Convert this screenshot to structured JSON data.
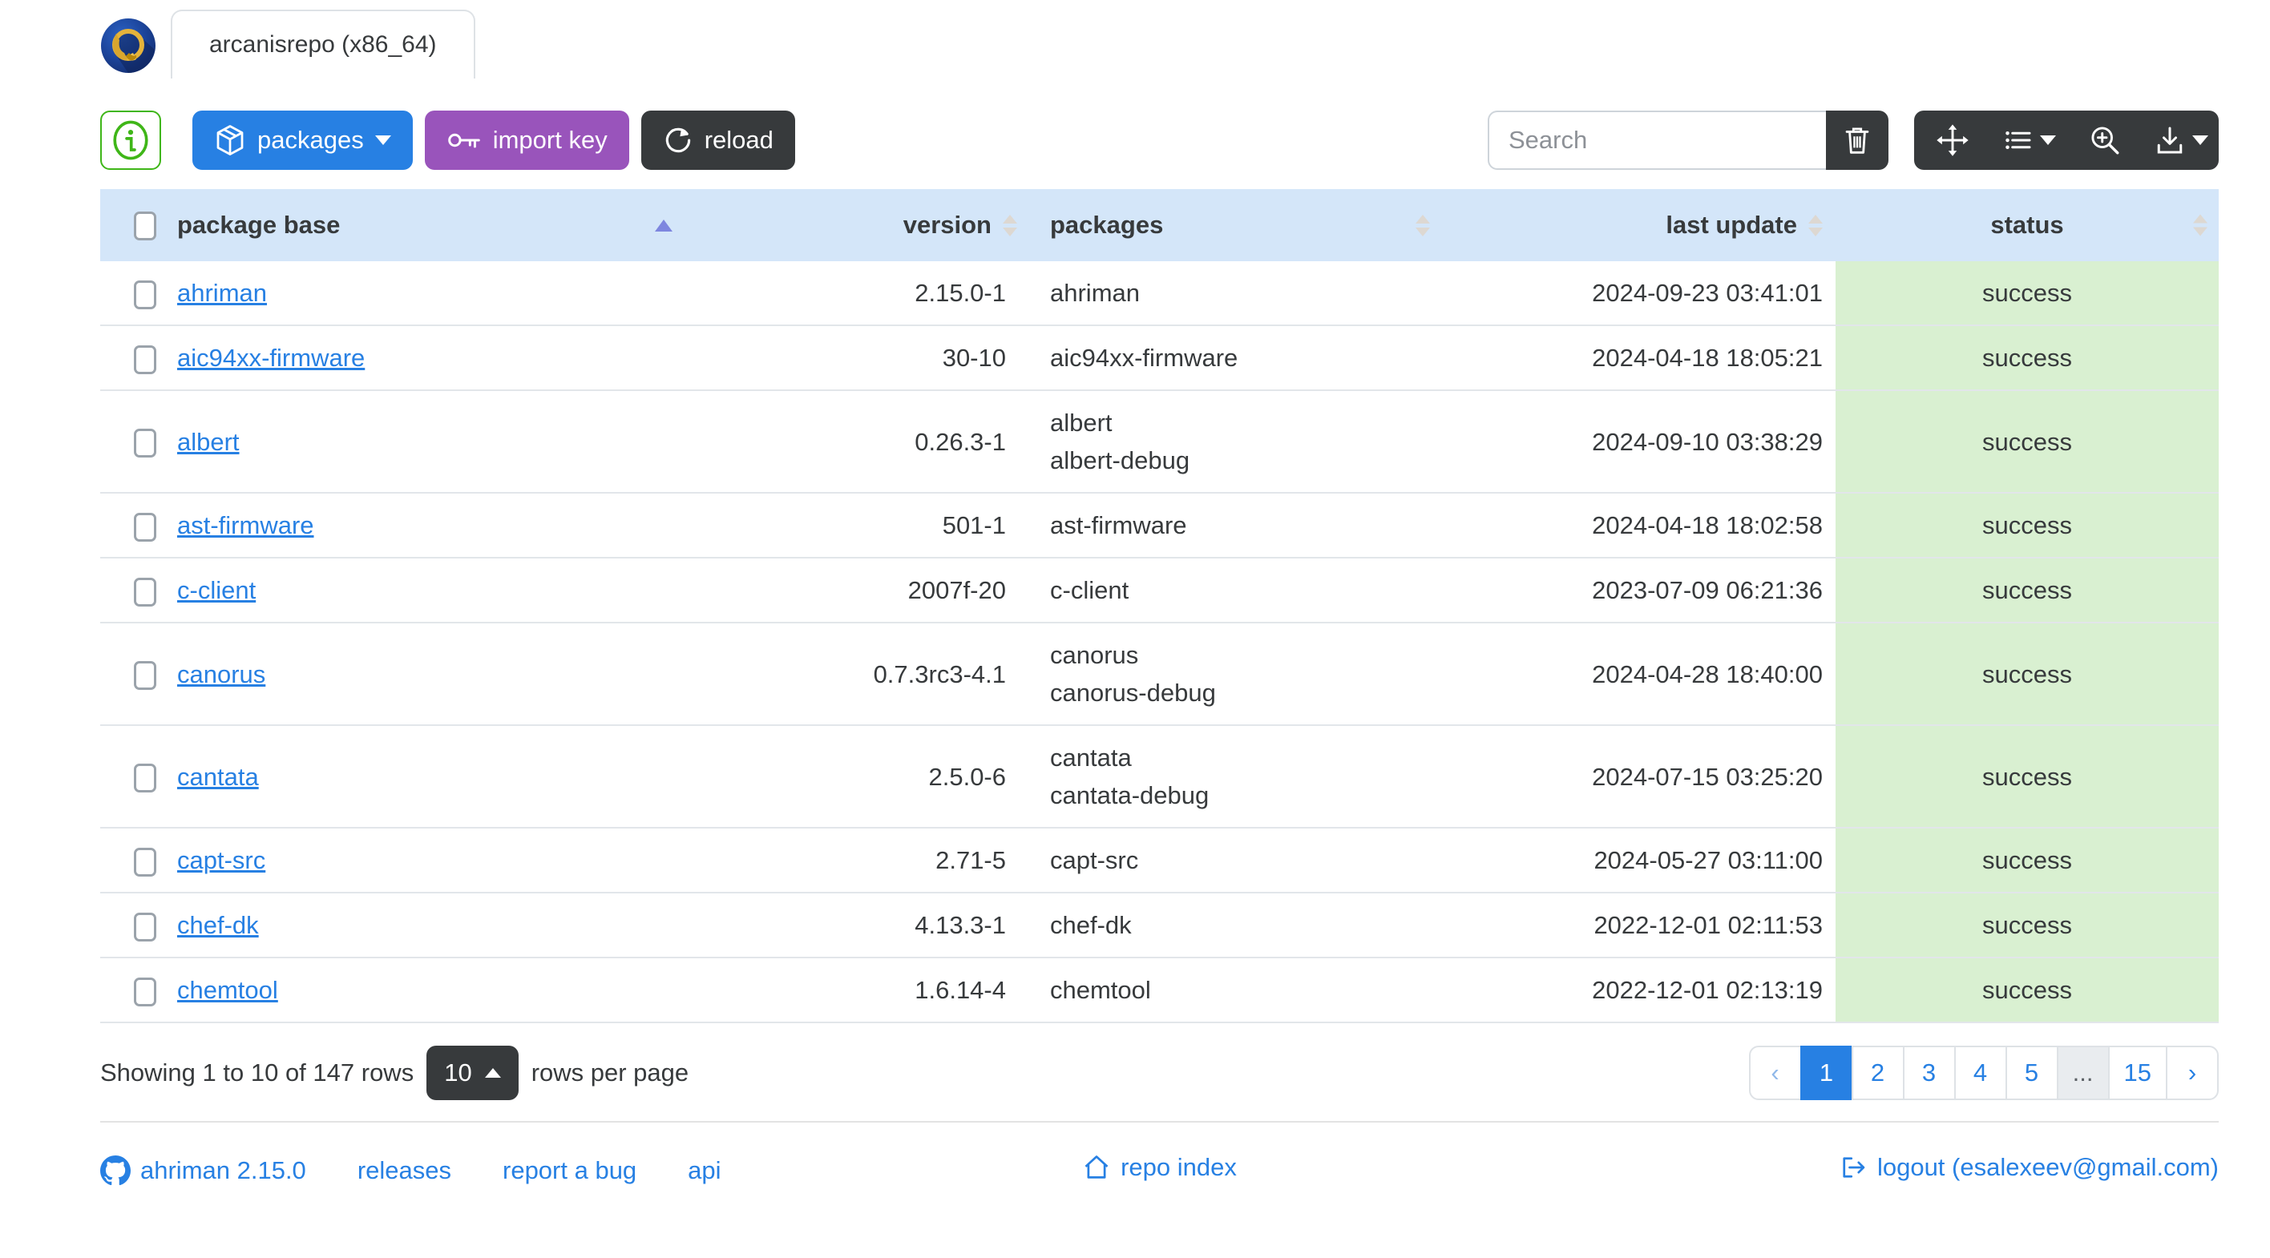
{
  "window": {
    "tab_title": "arcanisrepo (x86_64)"
  },
  "toolbar": {
    "packages_label": "packages",
    "import_key_label": "import key",
    "reload_label": "reload",
    "search_placeholder": "Search"
  },
  "table": {
    "headers": {
      "package_base": "package base",
      "version": "version",
      "packages": "packages",
      "last_update": "last update",
      "status": "status"
    },
    "rows": [
      {
        "base": "ahriman",
        "version": "2.15.0-1",
        "packages": [
          "ahriman"
        ],
        "last_update": "2024-09-23 03:41:01",
        "status": "success"
      },
      {
        "base": "aic94xx-firmware",
        "version": "30-10",
        "packages": [
          "aic94xx-firmware"
        ],
        "last_update": "2024-04-18 18:05:21",
        "status": "success"
      },
      {
        "base": "albert",
        "version": "0.26.3-1",
        "packages": [
          "albert",
          "albert-debug"
        ],
        "last_update": "2024-09-10 03:38:29",
        "status": "success"
      },
      {
        "base": "ast-firmware",
        "version": "501-1",
        "packages": [
          "ast-firmware"
        ],
        "last_update": "2024-04-18 18:02:58",
        "status": "success"
      },
      {
        "base": "c-client",
        "version": "2007f-20",
        "packages": [
          "c-client"
        ],
        "last_update": "2023-07-09 06:21:36",
        "status": "success"
      },
      {
        "base": "canorus",
        "version": "0.7.3rc3-4.1",
        "packages": [
          "canorus",
          "canorus-debug"
        ],
        "last_update": "2024-04-28 18:40:00",
        "status": "success"
      },
      {
        "base": "cantata",
        "version": "2.5.0-6",
        "packages": [
          "cantata",
          "cantata-debug"
        ],
        "last_update": "2024-07-15 03:25:20",
        "status": "success"
      },
      {
        "base": "capt-src",
        "version": "2.71-5",
        "packages": [
          "capt-src"
        ],
        "last_update": "2024-05-27 03:11:00",
        "status": "success"
      },
      {
        "base": "chef-dk",
        "version": "4.13.3-1",
        "packages": [
          "chef-dk"
        ],
        "last_update": "2022-12-01 02:11:53",
        "status": "success"
      },
      {
        "base": "chemtool",
        "version": "1.6.14-4",
        "packages": [
          "chemtool"
        ],
        "last_update": "2022-12-01 02:13:19",
        "status": "success"
      }
    ]
  },
  "pagination": {
    "summary": "Showing 1 to 10 of 147 rows",
    "page_size": "10",
    "rows_per_page_label": "rows per page",
    "prev": "‹",
    "next": "›",
    "pages": [
      "1",
      "2",
      "3",
      "4",
      "5",
      "...",
      "15"
    ],
    "active_page": "1"
  },
  "footer": {
    "version_link": "ahriman 2.15.0",
    "releases_link": "releases",
    "report_bug_link": "report a bug",
    "api_link": "api",
    "repo_index_link": "repo index",
    "logout_link": "logout (esalexeev@gmail.com)"
  },
  "colors": {
    "primary": "#2780e3",
    "secondary": "#373a3c",
    "success": "#3fb618",
    "purple": "#9954bb",
    "table_header_bg": "#d4e6f9",
    "status_cell_bg": "#d9f0d1"
  }
}
